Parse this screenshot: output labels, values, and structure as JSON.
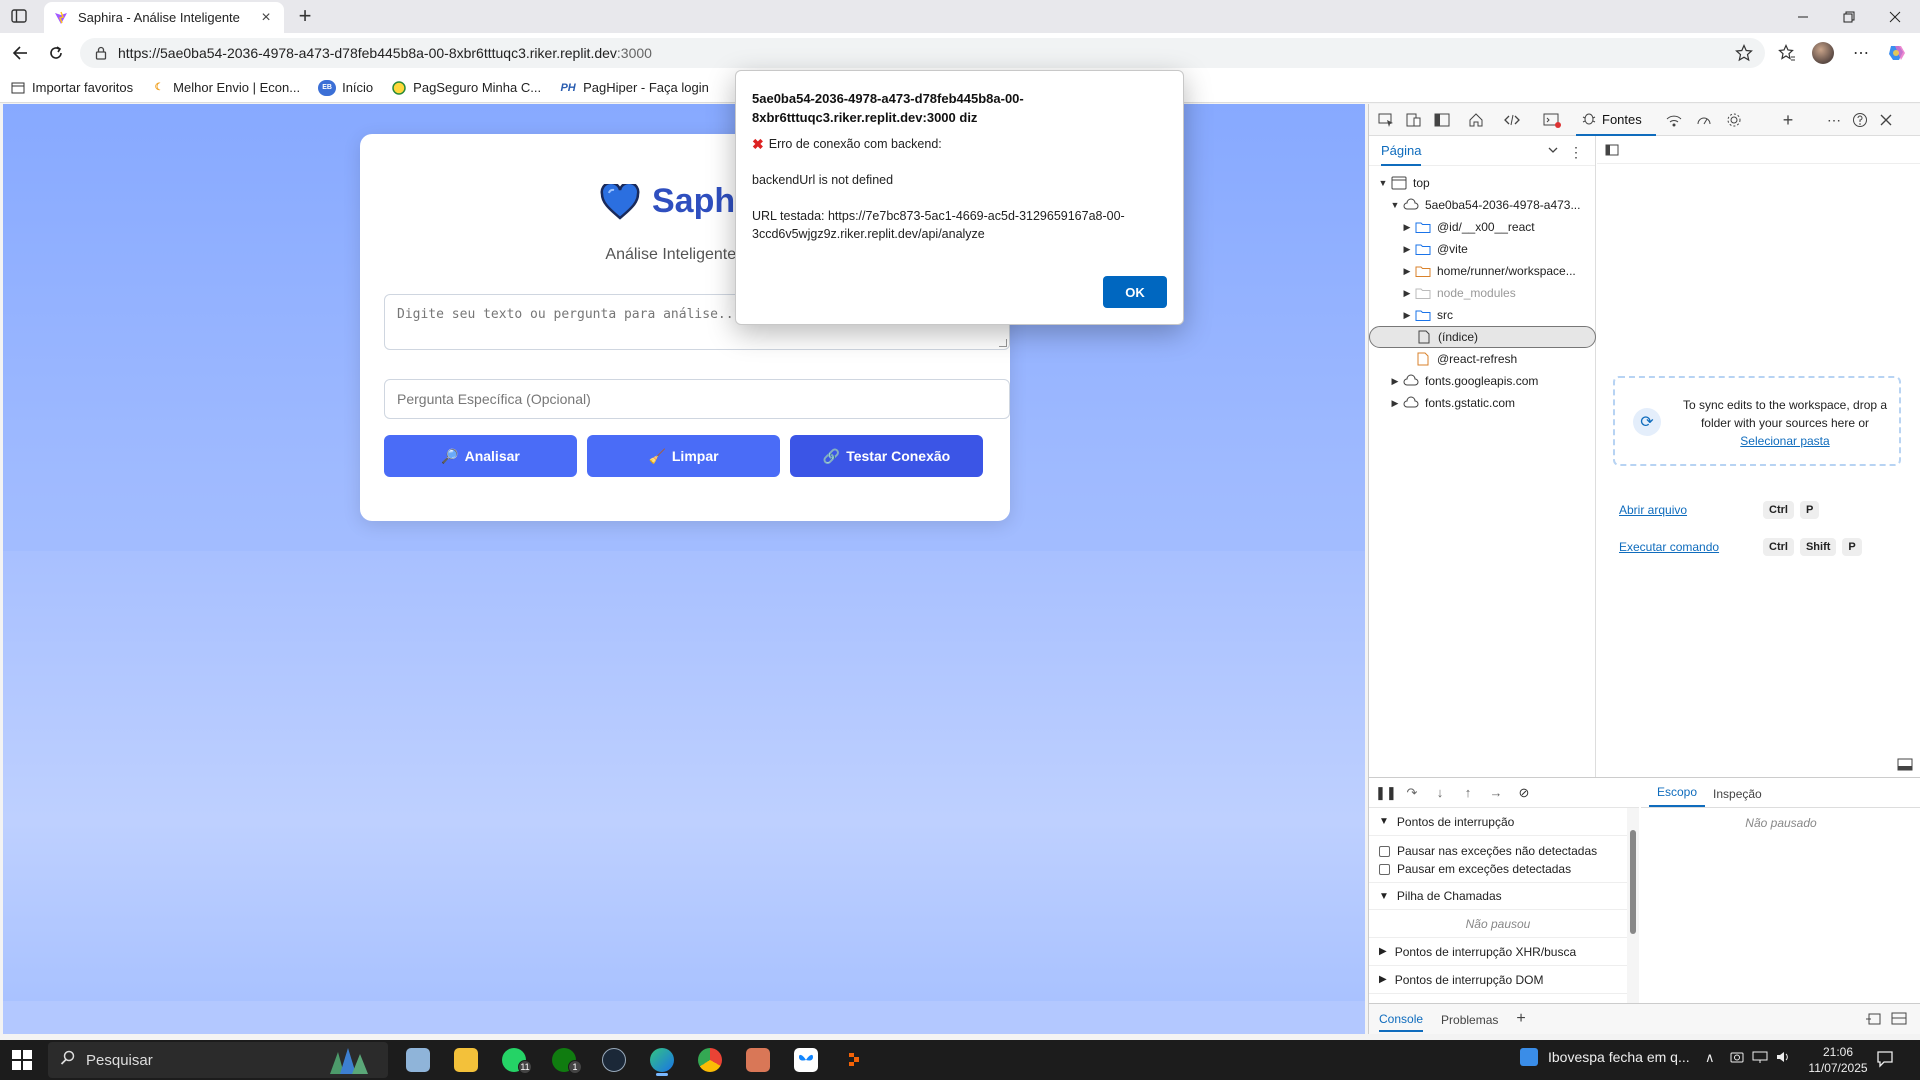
{
  "browser": {
    "tab_title": "Saphira - Análise Inteligente",
    "new_tab": "+",
    "url_host": "https://5ae0ba54-2036-4978-a473-d78feb445b8a-00-8xbr6tttuqc3.riker.replit.dev",
    "url_port": ":3000",
    "favorites": [
      {
        "label": "Importar favoritos",
        "icon": "import-icon"
      },
      {
        "label": "Melhor Envio | Econ...",
        "icon": "moon-icon"
      },
      {
        "label": "Início",
        "icon": "eb-icon"
      },
      {
        "label": "PagSeguro Minha C...",
        "icon": "pagseguro-icon"
      },
      {
        "label": "PagHiper - Faça login",
        "icon": "ph-icon"
      }
    ],
    "fav_ph_glyph": "PH",
    "fav_eb_glyph": "EB"
  },
  "app": {
    "brand_name": "Saphi",
    "subtitle": "Análise Inteligente e E",
    "textarea_placeholder": "Digite seu texto ou pergunta para análise...",
    "question_placeholder": "Pergunta Específica (Opcional)",
    "buttons": {
      "analyze": {
        "icon": "🔎",
        "label": "Analisar"
      },
      "clear": {
        "icon": "🧹",
        "label": "Limpar"
      },
      "test": {
        "icon": "🔗",
        "label": "Testar Conexão"
      }
    },
    "colors": {
      "primary": "#4a6cf7",
      "secondary": "#3b55e6",
      "brand": "#2f4fbf"
    }
  },
  "dialog": {
    "host": "5ae0ba54-2036-4978-a473-d78feb445b8a-00-8xbr6tttuqc3.riker.replit.dev:3000 diz",
    "error_icon": "✖",
    "error_line": "Erro de conexão com backend:",
    "message": "backendUrl is not defined",
    "url_tested": "URL testada: https://7e7bc873-5ac1-4669-ac5d-3129659167a8-00-3ccd6v5wjgz9z.riker.replit.dev/api/analyze",
    "ok": "OK"
  },
  "devtools": {
    "active_tab": "Fontes",
    "nav_tab": "Página",
    "tree": [
      {
        "level": 0,
        "arrow": "▼",
        "icon": "frame",
        "label": "top"
      },
      {
        "level": 1,
        "arrow": "▼",
        "icon": "cloud",
        "label": "5ae0ba54-2036-4978-a473..."
      },
      {
        "level": 2,
        "arrow": "▶",
        "icon": "folder",
        "label": "@id/__x00__react"
      },
      {
        "level": 2,
        "arrow": "▶",
        "icon": "folder",
        "label": "@vite"
      },
      {
        "level": 2,
        "arrow": "▶",
        "icon": "folder-orange",
        "label": "home/runner/workspace..."
      },
      {
        "level": 2,
        "arrow": "▶",
        "icon": "folder-muted",
        "label": "node_modules",
        "muted": true
      },
      {
        "level": 2,
        "arrow": "▶",
        "icon": "folder",
        "label": "src"
      },
      {
        "level": 2,
        "arrow": "",
        "icon": "file",
        "label": "(índice)",
        "selected": true
      },
      {
        "level": 2,
        "arrow": "",
        "icon": "file-orange",
        "label": "@react-refresh"
      },
      {
        "level": 1,
        "arrow": "▶",
        "icon": "cloud",
        "label": "fonts.googleapis.com"
      },
      {
        "level": 1,
        "arrow": "▶",
        "icon": "cloud",
        "label": "fonts.gstatic.com"
      }
    ],
    "sync_text": "To sync edits to the workspace, drop a folder with your sources here or",
    "sync_link": "Selecionar pasta",
    "commands": [
      {
        "label": "Abrir arquivo",
        "keys": [
          "Ctrl",
          "P"
        ]
      },
      {
        "label": "Executar comando",
        "keys": [
          "Ctrl",
          "Shift",
          "P"
        ]
      }
    ],
    "debugger": {
      "breakpoints": "Pontos de interrupção",
      "pause_uncaught": "Pausar nas exceções não detectadas",
      "pause_caught": "Pausar em exceções detectadas",
      "call_stack": "Pilha de Chamadas",
      "not_paused_stack": "Não pausou",
      "xhr": "Pontos de interrupção XHR/busca",
      "dom": "Pontos de interrupção DOM"
    },
    "scope_tabs": [
      "Escopo",
      "Inspeção"
    ],
    "scope_empty": "Não pausado",
    "drawer_tabs": [
      "Console",
      "Problemas"
    ]
  },
  "taskbar": {
    "search_placeholder": "Pesquisar",
    "whatsapp_badge": "11",
    "xbox_badge": "1",
    "news": "Ibovespa fecha em q...",
    "time": "21:06",
    "date": "11/07/2025"
  }
}
